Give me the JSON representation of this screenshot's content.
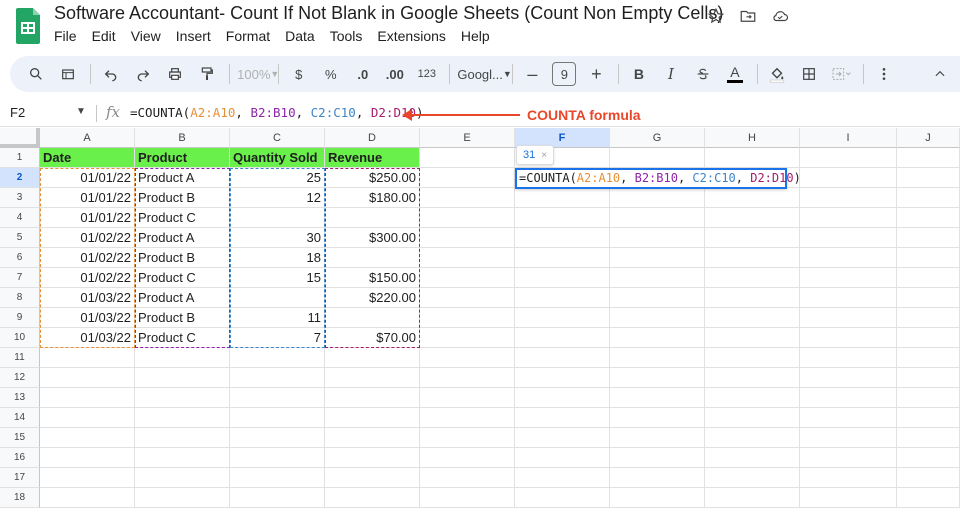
{
  "document": {
    "title": "Software Accountant- Count If Not Blank in Google Sheets (Count Non Empty Cells)"
  },
  "menu": [
    "File",
    "Edit",
    "View",
    "Insert",
    "Format",
    "Data",
    "Tools",
    "Extensions",
    "Help"
  ],
  "toolbar": {
    "zoom": "100%",
    "currency": "$",
    "percent": "%",
    "dec_decrease": ".0",
    "dec_increase": ".00",
    "number_format": "123",
    "font": "Googl...",
    "font_size": "9",
    "minus": "–",
    "plus": "+",
    "bold": "B",
    "italic": "I",
    "text_color_letter": "A"
  },
  "formula_bar": {
    "name_box": "F2",
    "fx": "fx",
    "formula_parts": [
      "=COUNTA(",
      "A2:A10",
      ", ",
      "B2:B10",
      ", ",
      "C2:C10",
      ", ",
      "D2:D10",
      ")"
    ]
  },
  "annotation": {
    "text": "COUNTA formula",
    "color": "#e8472a"
  },
  "grid": {
    "columns": [
      "A",
      "B",
      "C",
      "D",
      "E",
      "F",
      "G",
      "H",
      "I",
      "J"
    ],
    "selected_column": "F",
    "rows": [
      "1",
      "2",
      "3",
      "4",
      "5",
      "6",
      "7",
      "8",
      "9",
      "10",
      "11",
      "12",
      "13",
      "14",
      "15",
      "16",
      "17",
      "18"
    ],
    "selected_row": "2",
    "header_fill": "#6af04b",
    "headers": [
      "Date",
      "Product",
      "Quantity Sold",
      "Revenue"
    ],
    "data": [
      [
        "01/01/22",
        "Product A",
        "25",
        "$250.00"
      ],
      [
        "01/01/22",
        "Product B",
        "12",
        "$180.00"
      ],
      [
        "01/01/22",
        "Product C",
        "",
        ""
      ],
      [
        "01/02/22",
        "Product A",
        "30",
        "$300.00"
      ],
      [
        "01/02/22",
        "Product B",
        "18",
        ""
      ],
      [
        "01/02/22",
        "Product C",
        "15",
        "$150.00"
      ],
      [
        "01/03/22",
        "Product A",
        "",
        "$220.00"
      ],
      [
        "01/03/22",
        "Product B",
        "11",
        ""
      ],
      [
        "01/03/22",
        "Product C",
        "7",
        "$70.00"
      ]
    ],
    "range_colors": [
      "#e69138",
      "#8e24aa",
      "#3d85c6",
      "#a61c6b"
    ]
  },
  "edit_cell": {
    "parts": [
      "=COUNTA(",
      "A2:A10",
      ", ",
      "B2:B10",
      ", ",
      "C2:C10",
      ", ",
      "D2:D10",
      ")"
    ]
  },
  "result_tooltip": {
    "value": "31",
    "close": "×"
  }
}
